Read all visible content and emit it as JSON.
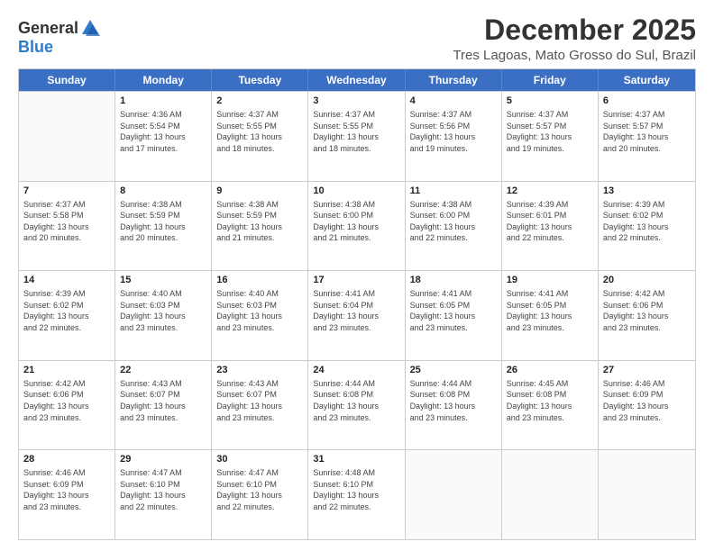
{
  "header": {
    "logo": {
      "line1": "General",
      "line2": "Blue"
    },
    "title": "December 2025",
    "subtitle": "Tres Lagoas, Mato Grosso do Sul, Brazil"
  },
  "calendar": {
    "days": [
      "Sunday",
      "Monday",
      "Tuesday",
      "Wednesday",
      "Thursday",
      "Friday",
      "Saturday"
    ],
    "rows": [
      [
        {
          "date": "",
          "info": ""
        },
        {
          "date": "1",
          "info": "Sunrise: 4:36 AM\nSunset: 5:54 PM\nDaylight: 13 hours\nand 17 minutes."
        },
        {
          "date": "2",
          "info": "Sunrise: 4:37 AM\nSunset: 5:55 PM\nDaylight: 13 hours\nand 18 minutes."
        },
        {
          "date": "3",
          "info": "Sunrise: 4:37 AM\nSunset: 5:55 PM\nDaylight: 13 hours\nand 18 minutes."
        },
        {
          "date": "4",
          "info": "Sunrise: 4:37 AM\nSunset: 5:56 PM\nDaylight: 13 hours\nand 19 minutes."
        },
        {
          "date": "5",
          "info": "Sunrise: 4:37 AM\nSunset: 5:57 PM\nDaylight: 13 hours\nand 19 minutes."
        },
        {
          "date": "6",
          "info": "Sunrise: 4:37 AM\nSunset: 5:57 PM\nDaylight: 13 hours\nand 20 minutes."
        }
      ],
      [
        {
          "date": "7",
          "info": "Sunrise: 4:37 AM\nSunset: 5:58 PM\nDaylight: 13 hours\nand 20 minutes."
        },
        {
          "date": "8",
          "info": "Sunrise: 4:38 AM\nSunset: 5:59 PM\nDaylight: 13 hours\nand 20 minutes."
        },
        {
          "date": "9",
          "info": "Sunrise: 4:38 AM\nSunset: 5:59 PM\nDaylight: 13 hours\nand 21 minutes."
        },
        {
          "date": "10",
          "info": "Sunrise: 4:38 AM\nSunset: 6:00 PM\nDaylight: 13 hours\nand 21 minutes."
        },
        {
          "date": "11",
          "info": "Sunrise: 4:38 AM\nSunset: 6:00 PM\nDaylight: 13 hours\nand 22 minutes."
        },
        {
          "date": "12",
          "info": "Sunrise: 4:39 AM\nSunset: 6:01 PM\nDaylight: 13 hours\nand 22 minutes."
        },
        {
          "date": "13",
          "info": "Sunrise: 4:39 AM\nSunset: 6:02 PM\nDaylight: 13 hours\nand 22 minutes."
        }
      ],
      [
        {
          "date": "14",
          "info": "Sunrise: 4:39 AM\nSunset: 6:02 PM\nDaylight: 13 hours\nand 22 minutes."
        },
        {
          "date": "15",
          "info": "Sunrise: 4:40 AM\nSunset: 6:03 PM\nDaylight: 13 hours\nand 23 minutes."
        },
        {
          "date": "16",
          "info": "Sunrise: 4:40 AM\nSunset: 6:03 PM\nDaylight: 13 hours\nand 23 minutes."
        },
        {
          "date": "17",
          "info": "Sunrise: 4:41 AM\nSunset: 6:04 PM\nDaylight: 13 hours\nand 23 minutes."
        },
        {
          "date": "18",
          "info": "Sunrise: 4:41 AM\nSunset: 6:05 PM\nDaylight: 13 hours\nand 23 minutes."
        },
        {
          "date": "19",
          "info": "Sunrise: 4:41 AM\nSunset: 6:05 PM\nDaylight: 13 hours\nand 23 minutes."
        },
        {
          "date": "20",
          "info": "Sunrise: 4:42 AM\nSunset: 6:06 PM\nDaylight: 13 hours\nand 23 minutes."
        }
      ],
      [
        {
          "date": "21",
          "info": "Sunrise: 4:42 AM\nSunset: 6:06 PM\nDaylight: 13 hours\nand 23 minutes."
        },
        {
          "date": "22",
          "info": "Sunrise: 4:43 AM\nSunset: 6:07 PM\nDaylight: 13 hours\nand 23 minutes."
        },
        {
          "date": "23",
          "info": "Sunrise: 4:43 AM\nSunset: 6:07 PM\nDaylight: 13 hours\nand 23 minutes."
        },
        {
          "date": "24",
          "info": "Sunrise: 4:44 AM\nSunset: 6:08 PM\nDaylight: 13 hours\nand 23 minutes."
        },
        {
          "date": "25",
          "info": "Sunrise: 4:44 AM\nSunset: 6:08 PM\nDaylight: 13 hours\nand 23 minutes."
        },
        {
          "date": "26",
          "info": "Sunrise: 4:45 AM\nSunset: 6:08 PM\nDaylight: 13 hours\nand 23 minutes."
        },
        {
          "date": "27",
          "info": "Sunrise: 4:46 AM\nSunset: 6:09 PM\nDaylight: 13 hours\nand 23 minutes."
        }
      ],
      [
        {
          "date": "28",
          "info": "Sunrise: 4:46 AM\nSunset: 6:09 PM\nDaylight: 13 hours\nand 23 minutes."
        },
        {
          "date": "29",
          "info": "Sunrise: 4:47 AM\nSunset: 6:10 PM\nDaylight: 13 hours\nand 22 minutes."
        },
        {
          "date": "30",
          "info": "Sunrise: 4:47 AM\nSunset: 6:10 PM\nDaylight: 13 hours\nand 22 minutes."
        },
        {
          "date": "31",
          "info": "Sunrise: 4:48 AM\nSunset: 6:10 PM\nDaylight: 13 hours\nand 22 minutes."
        },
        {
          "date": "",
          "info": ""
        },
        {
          "date": "",
          "info": ""
        },
        {
          "date": "",
          "info": ""
        }
      ]
    ]
  }
}
